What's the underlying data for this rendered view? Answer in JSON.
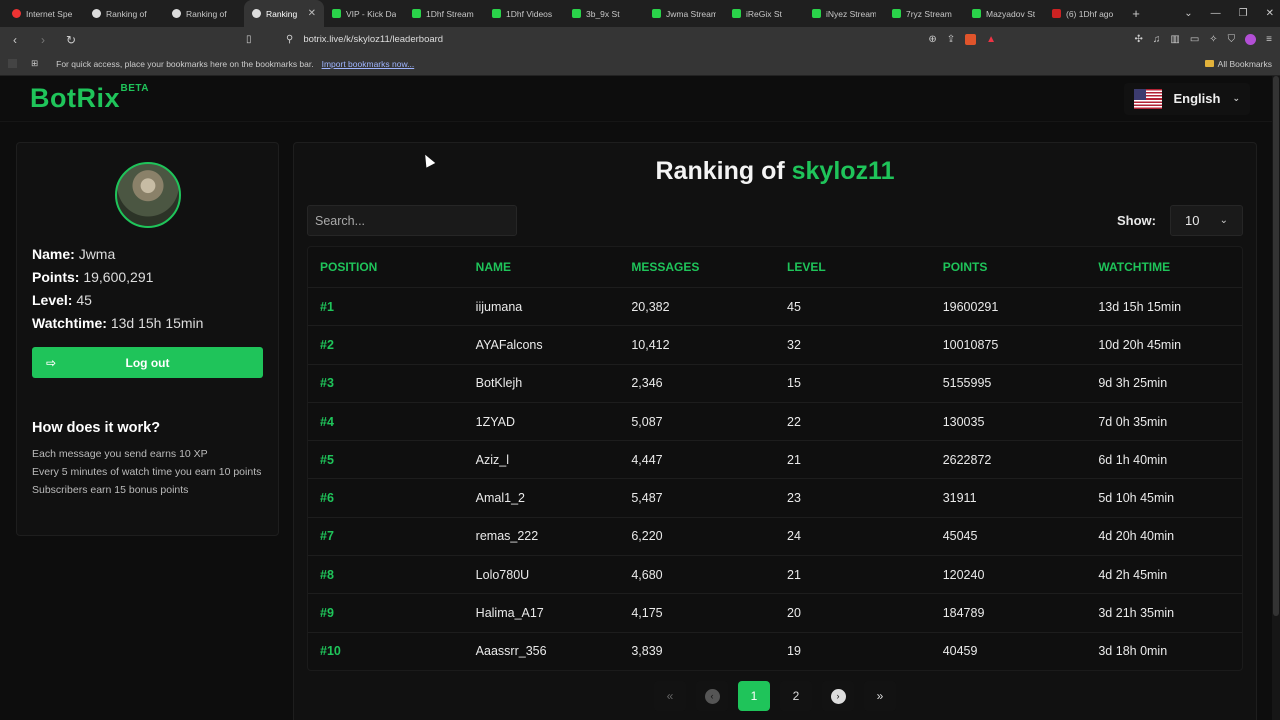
{
  "browser": {
    "tabs": [
      {
        "title": "Internet Spe",
        "icon": "r"
      },
      {
        "title": "Ranking of",
        "icon": "w"
      },
      {
        "title": "Ranking of",
        "icon": "w"
      },
      {
        "title": "Ranking",
        "icon": "w",
        "active": true
      },
      {
        "title": "VIP - Kick Da",
        "icon": "k"
      },
      {
        "title": "1Dhf Stream",
        "icon": "k"
      },
      {
        "title": "1Dhf Videos",
        "icon": "k"
      },
      {
        "title": "3b_9x St",
        "icon": "k"
      },
      {
        "title": "Jwma Stream",
        "icon": "k"
      },
      {
        "title": "iReGix St",
        "icon": "k"
      },
      {
        "title": "iNyez Stream",
        "icon": "k"
      },
      {
        "title": "7ryz Stream",
        "icon": "k"
      },
      {
        "title": "Mazyadov St",
        "icon": "k"
      },
      {
        "title": "(6) 1Dhf ago",
        "icon": "y"
      }
    ],
    "url": "botrix.live/k/skyloz11/leaderboard",
    "bookmarks_prompt": "For quick access, place your bookmarks here on the bookmarks bar.",
    "import_link": "Import bookmarks now...",
    "all_bookmarks": "All Bookmarks"
  },
  "header": {
    "logo": "BotRix",
    "beta": "BETA",
    "language": "English"
  },
  "profile": {
    "name_label": "Name:",
    "name": "Jwma",
    "points_label": "Points:",
    "points": "19,600,291",
    "level_label": "Level:",
    "level": "45",
    "watchtime_label": "Watchtime:",
    "watchtime": "13d 15h 15min",
    "logout_label": "Log out"
  },
  "how": {
    "title": "How does it work?",
    "lines": [
      "Each message you send earns 10 XP",
      "Every 5 minutes of watch time you earn 10 points",
      "Subscribers earn 15 bonus points"
    ]
  },
  "ranking": {
    "title_prefix": "Ranking of",
    "channel": "skyloz11",
    "search_placeholder": "Search...",
    "show_label": "Show:",
    "show_value": "10",
    "columns": [
      "POSITION",
      "NAME",
      "MESSAGES",
      "LEVEL",
      "POINTS",
      "WATCHTIME"
    ],
    "rows": [
      [
        "#1",
        "iijumana",
        "20,382",
        "45",
        "19600291",
        "13d 15h 15min"
      ],
      [
        "#2",
        "AYAFalcons",
        "10,412",
        "32",
        "10010875",
        "10d 20h 45min"
      ],
      [
        "#3",
        "BotKlejh",
        "2,346",
        "15",
        "5155995",
        "9d 3h 25min"
      ],
      [
        "#4",
        "1ZYAD",
        "5,087",
        "22",
        "130035",
        "7d 0h 35min"
      ],
      [
        "#5",
        "Aziz_l",
        "4,447",
        "21",
        "2622872",
        "6d 1h 40min"
      ],
      [
        "#6",
        "Amal1_2",
        "5,487",
        "23",
        "31911",
        "5d 10h 45min"
      ],
      [
        "#7",
        "remas_222",
        "6,220",
        "24",
        "45045",
        "4d 20h 40min"
      ],
      [
        "#8",
        "Lolo780U",
        "4,680",
        "21",
        "120240",
        "4d 2h 45min"
      ],
      [
        "#9",
        "Halima_A17",
        "4,175",
        "20",
        "184789",
        "3d 21h 35min"
      ],
      [
        "#10",
        "Aaassrr_356",
        "3,839",
        "19",
        "40459",
        "3d 18h 0min"
      ]
    ],
    "pagination": {
      "first": "«",
      "prev": "‹",
      "pages": [
        "1",
        "2"
      ],
      "current": "1",
      "next": "›",
      "last": "»"
    }
  }
}
